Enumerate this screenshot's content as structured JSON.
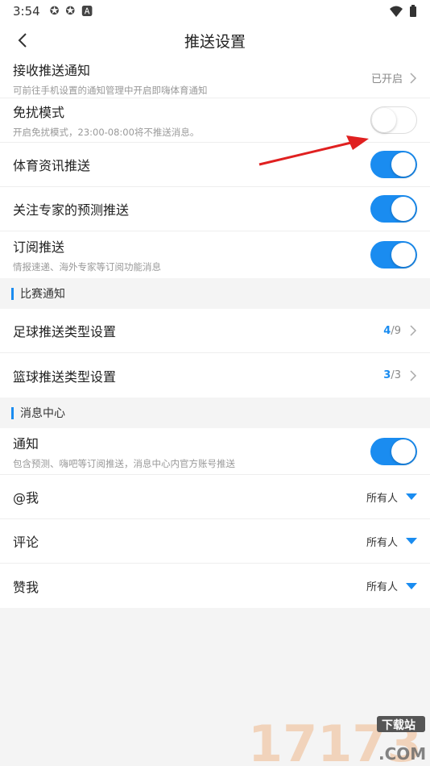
{
  "status": {
    "time": "3:54"
  },
  "header": {
    "title": "推送设置"
  },
  "rows1": [
    {
      "label": "接收推送通知",
      "sub": "可前往手机设置的通知管理中开启即嗨体育通知",
      "value": "已开启"
    },
    {
      "label": "免扰模式",
      "sub": "开启免扰模式，23:00-08:00将不推送消息。"
    },
    {
      "label": "体育资讯推送"
    },
    {
      "label": "关注专家的预测推送"
    },
    {
      "label": "订阅推送",
      "sub": "情报速递、海外专家等订阅功能消息"
    }
  ],
  "section_match": {
    "title": "比赛通知",
    "rows": [
      {
        "label": "足球推送类型设置",
        "cur": "4",
        "total": "/9"
      },
      {
        "label": "篮球推送类型设置",
        "cur": "3",
        "total": "/3"
      }
    ]
  },
  "section_msg": {
    "title": "消息中心",
    "notify": {
      "label": "通知",
      "sub": "包含预测、嗨吧等订阅推送，消息中心内官方账号推送"
    },
    "rows": [
      {
        "label": "@我",
        "value": "所有人"
      },
      {
        "label": "评论",
        "value": "所有人"
      },
      {
        "label": "赞我",
        "value": "所有人"
      }
    ]
  },
  "colors": {
    "accent": "#1a8cf0",
    "arrow": "#e02020"
  },
  "watermark": {
    "text": "17173",
    "badge": "下载站",
    "domain": ".COM"
  }
}
